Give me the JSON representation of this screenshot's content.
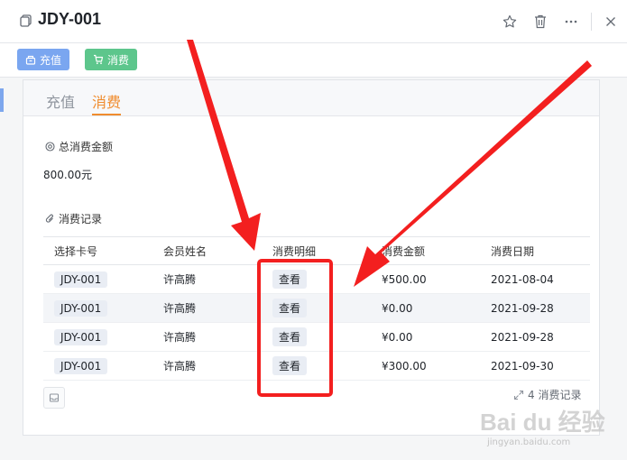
{
  "header": {
    "title": "JDY-001"
  },
  "toolbar": {
    "recharge_label": "充值",
    "spend_label": "消费"
  },
  "tabs": [
    {
      "label": "充值"
    },
    {
      "label": "消费"
    }
  ],
  "fields": {
    "total_label": "总消费金额",
    "total_value": "800.00元",
    "records_label": "消费记录"
  },
  "table": {
    "columns": [
      "选择卡号",
      "会员姓名",
      "消费明细",
      "消费金额",
      "消费日期"
    ],
    "rows": [
      {
        "card": "JDY-001",
        "name": "许高腾",
        "detail": "查看",
        "amount": "¥500.00",
        "date": "2021-08-04"
      },
      {
        "card": "JDY-001",
        "name": "许高腾",
        "detail": "查看",
        "amount": "¥0.00",
        "date": "2021-09-28"
      },
      {
        "card": "JDY-001",
        "name": "许高腾",
        "detail": "查看",
        "amount": "¥0.00",
        "date": "2021-09-28"
      },
      {
        "card": "JDY-001",
        "name": "许高腾",
        "detail": "查看",
        "amount": "¥300.00",
        "date": "2021-09-30"
      }
    ],
    "expand_label": "4 消费记录"
  },
  "watermark": {
    "brand": "Bai du 经验",
    "url": "jingyan.baidu.com"
  },
  "colors": {
    "accent": "#f08c2e",
    "recharge": "#7aa6f0",
    "spend": "#5dc68c",
    "annotation": "#f31f1f"
  }
}
